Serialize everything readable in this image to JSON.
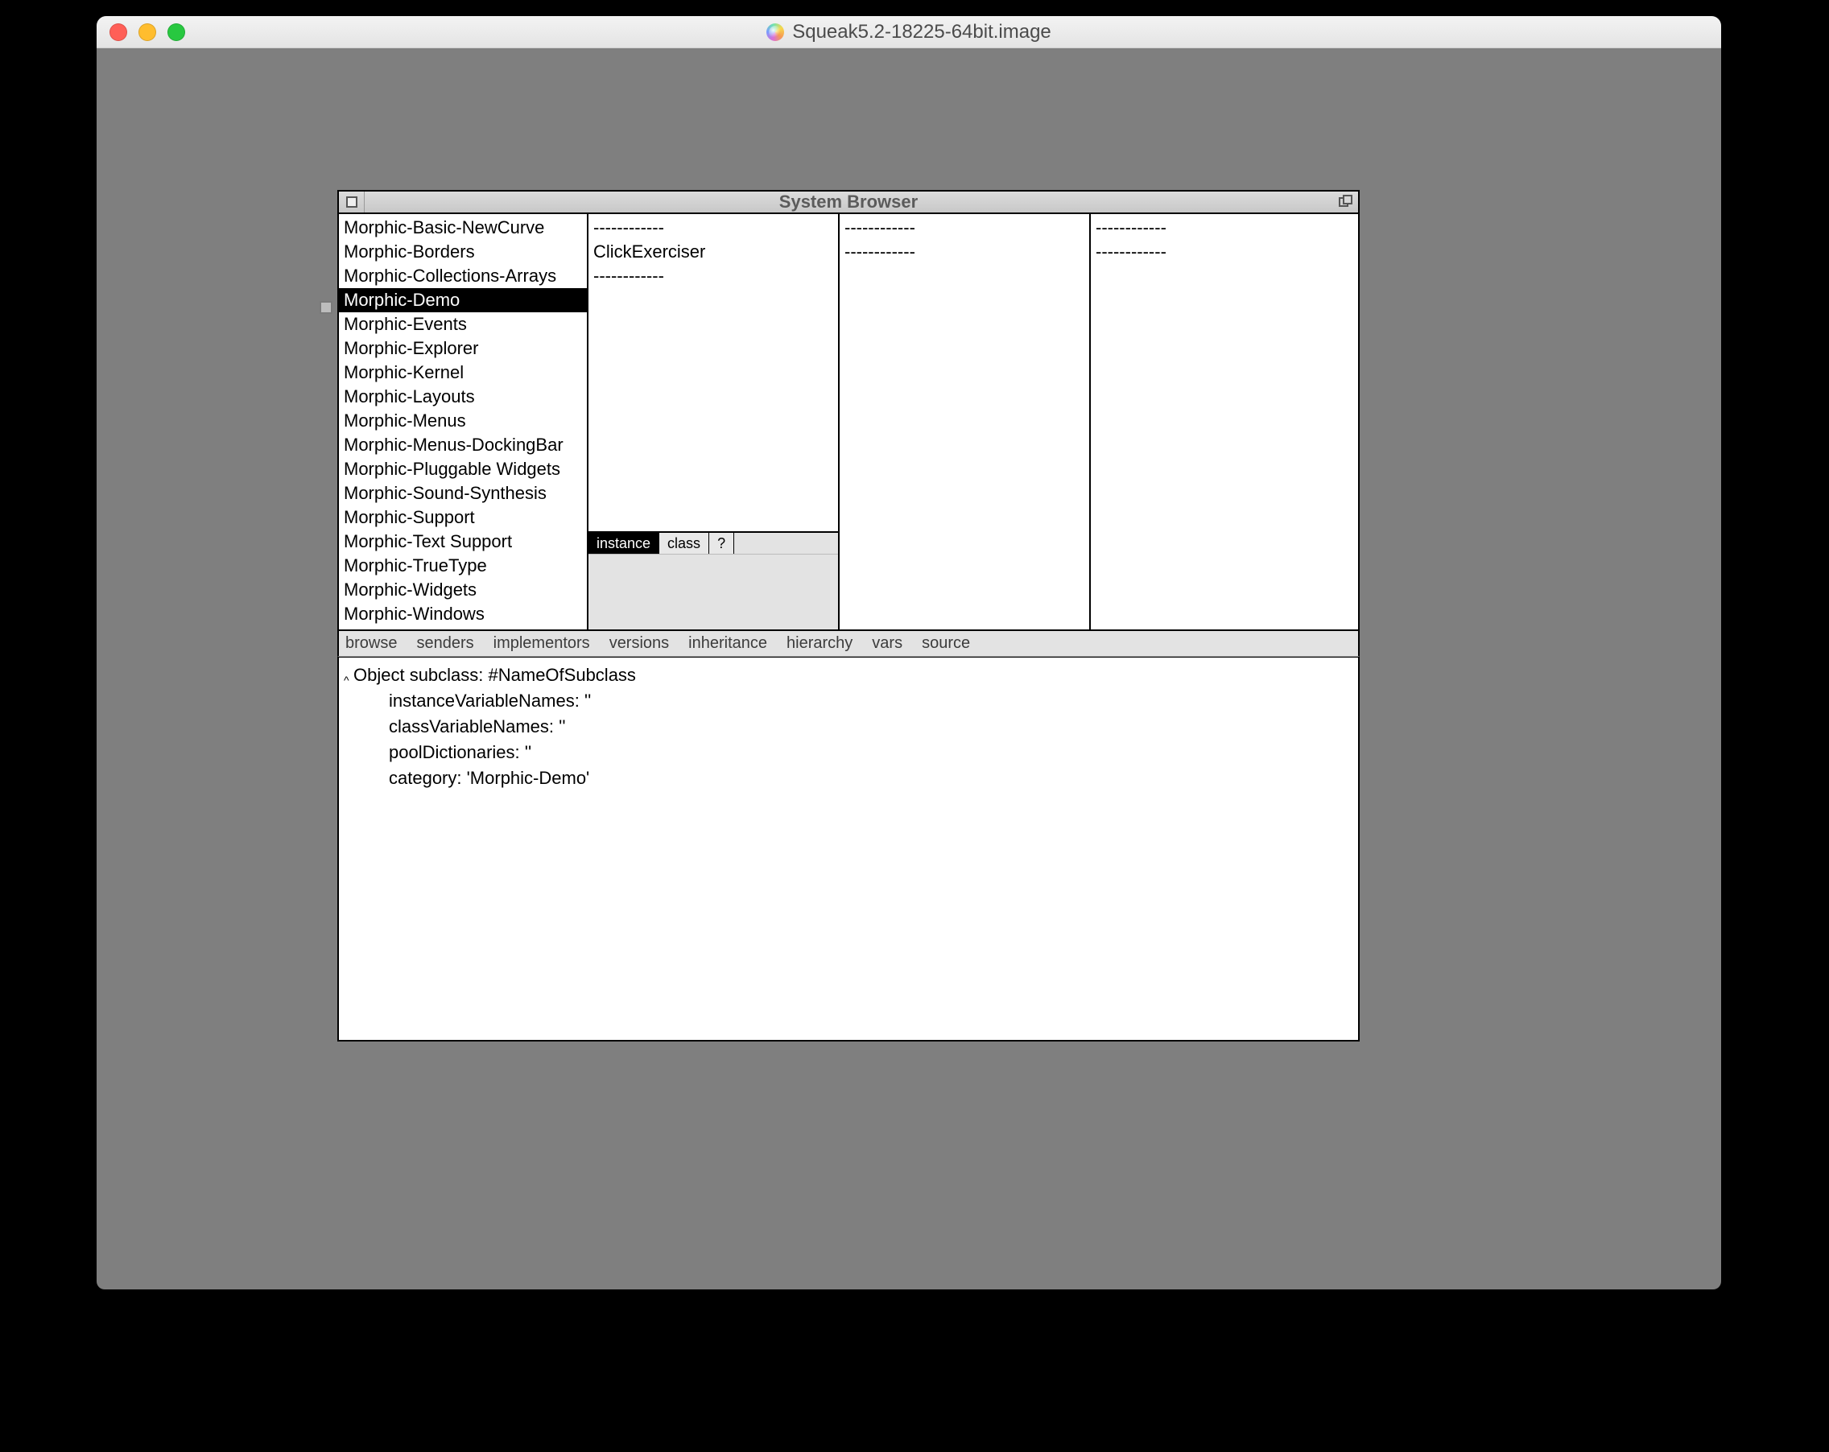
{
  "mac": {
    "title": "Squeak5.2-18225-64bit.image"
  },
  "browser": {
    "title": "System Browser",
    "categories": [
      "Morphic-Basic-NewCurve",
      "Morphic-Borders",
      "Morphic-Collections-Arrays",
      "Morphic-Demo",
      "Morphic-Events",
      "Morphic-Explorer",
      "Morphic-Kernel",
      "Morphic-Layouts",
      "Morphic-Menus",
      "Morphic-Menus-DockingBar",
      "Morphic-Pluggable Widgets",
      "Morphic-Sound-Synthesis",
      "Morphic-Support",
      "Morphic-Text Support",
      "Morphic-TrueType",
      "Morphic-Widgets",
      "Morphic-Windows"
    ],
    "selected_category_index": 3,
    "classes": [
      "------------",
      "ClickExerciser",
      "------------"
    ],
    "protocols": [
      "------------",
      "------------"
    ],
    "methods": [
      "------------",
      "------------"
    ],
    "switch": {
      "instance": "instance",
      "class": "class",
      "query": "?",
      "selected": "instance"
    },
    "actions": {
      "browse": "browse",
      "senders": "senders",
      "implementors": "implementors",
      "versions": "versions",
      "inheritance": "inheritance",
      "hierarchy": "hierarchy",
      "vars": "vars",
      "source": "source"
    },
    "code": {
      "line0": "Object subclass: #NameOfSubclass",
      "line1": "instanceVariableNames: ''",
      "line2": "classVariableNames: ''",
      "line3": "poolDictionaries: ''",
      "line4": "category: 'Morphic-Demo'"
    }
  }
}
